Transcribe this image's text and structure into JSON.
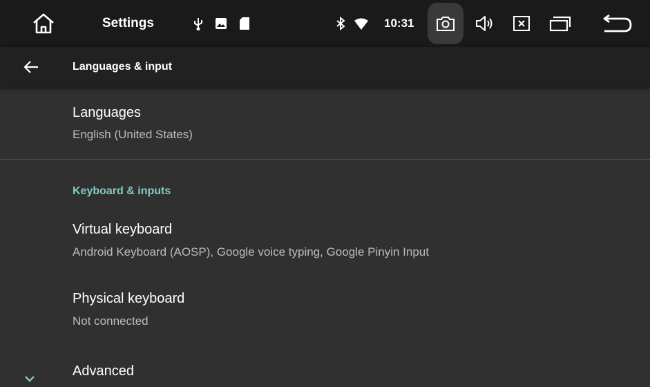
{
  "status_bar": {
    "title": "Settings",
    "time": "10:31",
    "icons": [
      "home-icon",
      "usb-icon",
      "image-icon",
      "sd-card-icon",
      "bluetooth-icon",
      "wifi-icon",
      "screenshot-icon",
      "volume-icon",
      "close-app-icon",
      "recents-icon",
      "back-icon"
    ]
  },
  "toolbar": {
    "title": "Languages & input"
  },
  "languages": {
    "title": "Languages",
    "summary": "English (United States)"
  },
  "keyboard_category": {
    "title": "Keyboard & inputs"
  },
  "virtual_keyboard": {
    "title": "Virtual keyboard",
    "summary": "Android Keyboard (AOSP), Google voice typing, Google Pinyin Input"
  },
  "physical_keyboard": {
    "title": "Physical keyboard",
    "summary": "Not connected"
  },
  "advanced": {
    "title": "Advanced"
  },
  "colors": {
    "accent": "#80cbc4",
    "background": "#303030",
    "status_bar": "#1a1a1a",
    "toolbar": "#212121"
  }
}
